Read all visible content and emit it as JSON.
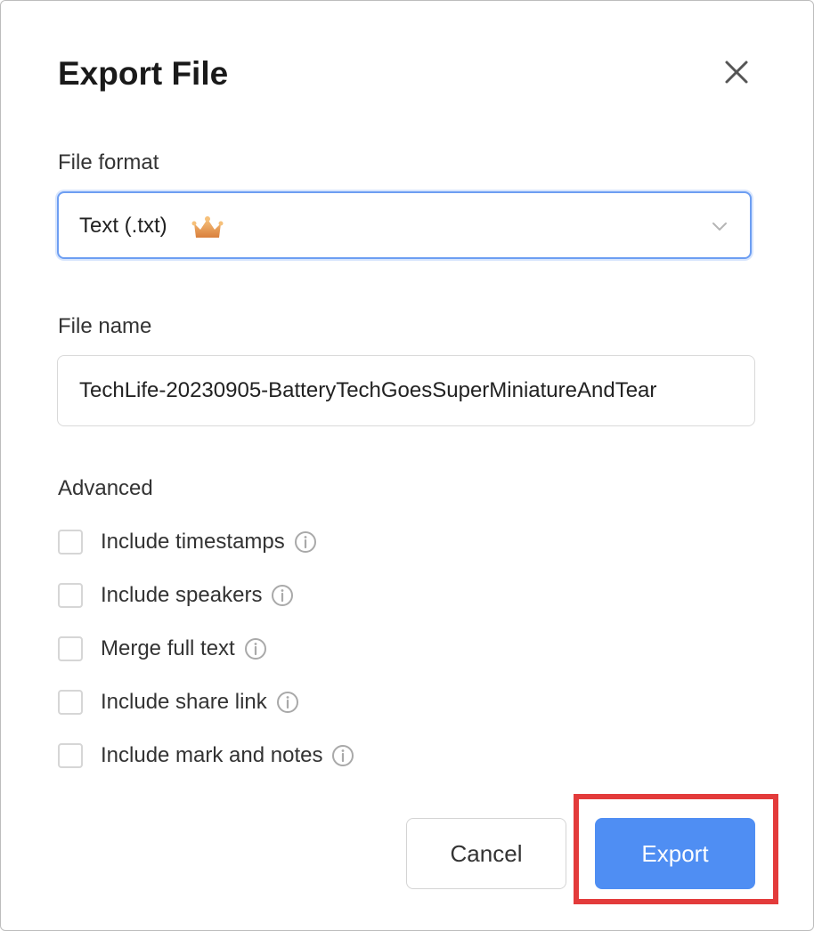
{
  "dialog": {
    "title": "Export File",
    "close_icon": "close-icon"
  },
  "file_format": {
    "label": "File format",
    "selected": "Text (.txt)",
    "badge_icon": "crown-icon",
    "chevron_icon": "chevron-down-icon"
  },
  "file_name": {
    "label": "File name",
    "value": "TechLife-20230905-BatteryTechGoesSuperMiniatureAndTear"
  },
  "advanced": {
    "label": "Advanced",
    "options": [
      {
        "label": "Include timestamps",
        "checked": false
      },
      {
        "label": "Include speakers",
        "checked": false
      },
      {
        "label": "Merge full text",
        "checked": false
      },
      {
        "label": "Include share link",
        "checked": false
      },
      {
        "label": "Include mark and notes",
        "checked": false
      }
    ]
  },
  "actions": {
    "cancel_label": "Cancel",
    "export_label": "Export"
  },
  "colors": {
    "accent": "#4f8ef3",
    "highlight": "#e33b3b",
    "crown": "#e9a15a"
  }
}
